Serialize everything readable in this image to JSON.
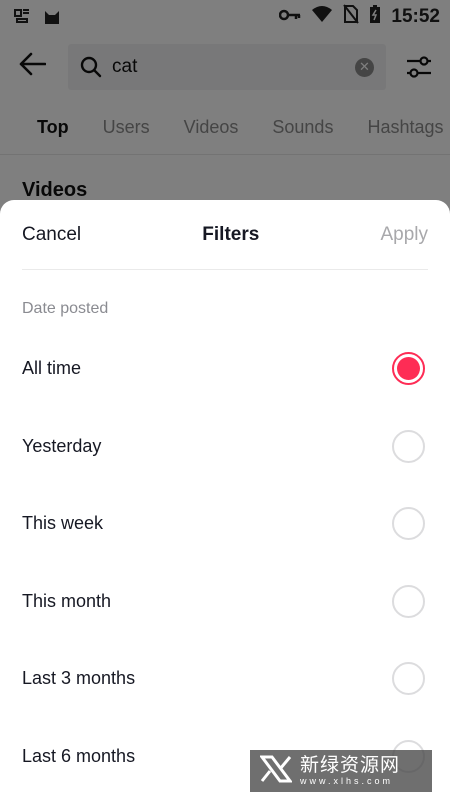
{
  "status_bar": {
    "time": "15:52",
    "left_icons": [
      "bug-icon",
      "cat-app-icon"
    ],
    "right_icons": [
      "key-icon",
      "wifi-icon",
      "no-sim-icon",
      "battery-icon"
    ]
  },
  "search": {
    "query": "cat"
  },
  "tabs": [
    "Top",
    "Users",
    "Videos",
    "Sounds",
    "Hashtags"
  ],
  "active_tab": "Top",
  "section_title": "Videos",
  "sheet": {
    "cancel_label": "Cancel",
    "title": "Filters",
    "apply_label": "Apply",
    "group_label": "Date posted",
    "options": [
      {
        "label": "All time",
        "selected": true
      },
      {
        "label": "Yesterday",
        "selected": false
      },
      {
        "label": "This week",
        "selected": false
      },
      {
        "label": "This month",
        "selected": false
      },
      {
        "label": "Last 3 months",
        "selected": false
      },
      {
        "label": "Last 6 months",
        "selected": false
      }
    ]
  },
  "watermark": {
    "text": "新绿资源网",
    "url": "www.xlhs.com"
  },
  "colors": {
    "accent": "#fe2c55",
    "apply_disabled": "#a8a8ab",
    "text": "#161823",
    "muted": "#8a8b91"
  }
}
